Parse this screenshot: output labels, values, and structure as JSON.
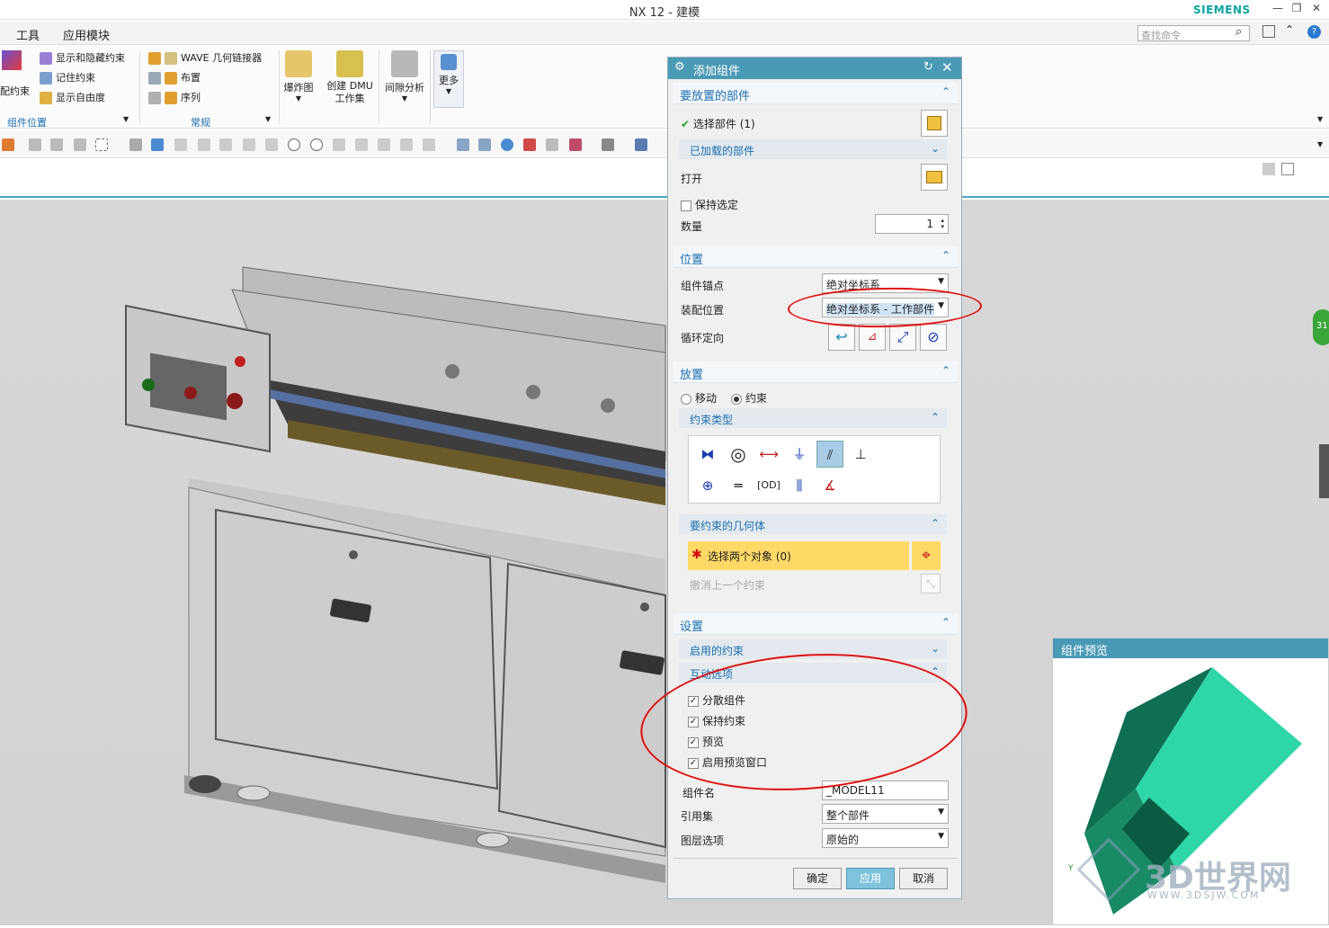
{
  "window": {
    "title": "NX 12 - 建模",
    "brand": "SIEMENS",
    "controls": [
      "—",
      "❐",
      "✕"
    ]
  },
  "menu": {
    "items": [
      "工具",
      "应用模块"
    ],
    "search_placeholder": "查找命令"
  },
  "ribbon": {
    "assembly_constraint_label": "配约束",
    "group1_items": [
      "显示和隐藏约束",
      "记住约束",
      "显示自由度"
    ],
    "group1_name": "组件位置",
    "group2_items": [
      "WAVE 几何链接器",
      "布置",
      "序列"
    ],
    "group2_name": "常规",
    "big_buttons": [
      "爆炸图",
      "创建 DMU\n工作集",
      "间隙分析",
      "更多"
    ]
  },
  "dialog": {
    "title": "添加组件",
    "sec_part": "要放置的部件",
    "select_part": "选择部件 (1)",
    "loaded_parts": "已加载的部件",
    "open": "打开",
    "keep_selected": "保持选定",
    "quantity_label": "数量",
    "quantity": "1",
    "sec_position": "位置",
    "anchor_label": "组件锚点",
    "anchor_value": "绝对坐标系",
    "assembly_pos_label": "装配位置",
    "assembly_pos_value": "绝对坐标系 - 工作部件",
    "cycle_orient_label": "循环定向",
    "sec_place": "放置",
    "move": "移动",
    "constraint": "约束",
    "constraint_type": "约束类型",
    "constraint_geometry": "要约束的几何体",
    "select_two": "选择两个对象 (0)",
    "undo_last": "撤消上一个约束",
    "sec_settings": "设置",
    "enabled_constraints": "启用的约束",
    "interaction_options": "互动选项",
    "options": [
      "分散组件",
      "保持约束",
      "预览",
      "启用预览窗口"
    ],
    "component_name_label": "组件名",
    "component_name": "_MODEL11",
    "ref_set_label": "引用集",
    "ref_set_value": "整个部件",
    "layer_label": "图层选项",
    "layer_value": "原始的",
    "ok": "确定",
    "apply": "应用",
    "cancel": "取消"
  },
  "preview": {
    "title": "组件预览",
    "watermark": "3D世界网",
    "watermark_url": "WWW.3DSJW.COM"
  },
  "side_badge": "31",
  "colors": {
    "accent": "#4a9ab5",
    "link": "#1a6fb0",
    "highlight": "#ffd966",
    "preview_solid": "#2fd6a7",
    "annotation": "#e01010"
  }
}
